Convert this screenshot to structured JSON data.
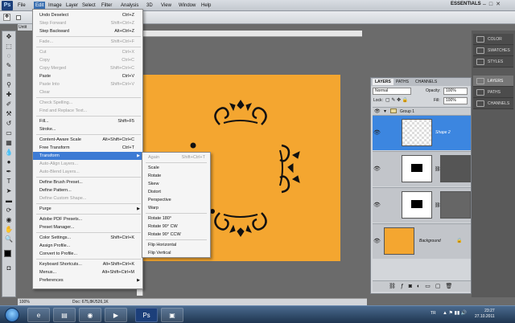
{
  "app": {
    "logo": "Ps",
    "workspace": "ESSENTIALS"
  },
  "menubar": [
    "File",
    "Edit",
    "Image",
    "Layer",
    "Select",
    "Filter",
    "Analysis",
    "3D",
    "View",
    "Window",
    "Help"
  ],
  "menubar_active": "Edit",
  "document_tab": "Untit",
  "edit_menu": [
    {
      "label": "Undo Deselect",
      "shortcut": "Ctrl+Z",
      "state": "enabled"
    },
    {
      "label": "Step Forward",
      "shortcut": "Shift+Ctrl+Z",
      "state": "disabled"
    },
    {
      "label": "Step Backward",
      "shortcut": "Alt+Ctrl+Z",
      "state": "enabled"
    },
    {
      "sep": true
    },
    {
      "label": "Fade...",
      "shortcut": "Shift+Ctrl+F",
      "state": "disabled"
    },
    {
      "sep": true
    },
    {
      "label": "Cut",
      "shortcut": "Ctrl+X",
      "state": "disabled"
    },
    {
      "label": "Copy",
      "shortcut": "Ctrl+C",
      "state": "disabled"
    },
    {
      "label": "Copy Merged",
      "shortcut": "Shift+Ctrl+C",
      "state": "disabled"
    },
    {
      "label": "Paste",
      "shortcut": "Ctrl+V",
      "state": "enabled"
    },
    {
      "label": "Paste Into",
      "shortcut": "Shift+Ctrl+V",
      "state": "disabled"
    },
    {
      "label": "Clear",
      "shortcut": "",
      "state": "disabled"
    },
    {
      "sep": true
    },
    {
      "label": "Check Spelling...",
      "shortcut": "",
      "state": "disabled"
    },
    {
      "label": "Find and Replace Text...",
      "shortcut": "",
      "state": "disabled"
    },
    {
      "sep": true
    },
    {
      "label": "Fill...",
      "shortcut": "Shift+F5",
      "state": "enabled"
    },
    {
      "label": "Stroke...",
      "shortcut": "",
      "state": "enabled"
    },
    {
      "sep": true
    },
    {
      "label": "Content-Aware Scale",
      "shortcut": "Alt+Shift+Ctrl+C",
      "state": "enabled"
    },
    {
      "label": "Free Transform",
      "shortcut": "Ctrl+T",
      "state": "enabled"
    },
    {
      "label": "Transform",
      "shortcut": "",
      "state": "highlighted",
      "submenu": true
    },
    {
      "label": "Auto-Align Layers...",
      "shortcut": "",
      "state": "disabled"
    },
    {
      "label": "Auto-Blend Layers...",
      "shortcut": "",
      "state": "disabled"
    },
    {
      "sep": true
    },
    {
      "label": "Define Brush Preset...",
      "shortcut": "",
      "state": "enabled"
    },
    {
      "label": "Define Pattern...",
      "shortcut": "",
      "state": "enabled"
    },
    {
      "label": "Define Custom Shape...",
      "shortcut": "",
      "state": "disabled"
    },
    {
      "sep": true
    },
    {
      "label": "Purge",
      "shortcut": "",
      "state": "enabled",
      "submenu": true
    },
    {
      "sep": true
    },
    {
      "label": "Adobe PDF Presets...",
      "shortcut": "",
      "state": "enabled"
    },
    {
      "label": "Preset Manager...",
      "shortcut": "",
      "state": "enabled"
    },
    {
      "sep": true
    },
    {
      "label": "Color Settings...",
      "shortcut": "Shift+Ctrl+K",
      "state": "enabled"
    },
    {
      "label": "Assign Profile...",
      "shortcut": "",
      "state": "enabled"
    },
    {
      "label": "Convert to Profile...",
      "shortcut": "",
      "state": "enabled"
    },
    {
      "sep": true
    },
    {
      "label": "Keyboard Shortcuts...",
      "shortcut": "Alt+Shift+Ctrl+K",
      "state": "enabled"
    },
    {
      "label": "Menus...",
      "shortcut": "Alt+Shift+Ctrl+M",
      "state": "enabled"
    },
    {
      "label": "Preferences",
      "shortcut": "",
      "state": "enabled",
      "submenu": true
    }
  ],
  "transform_submenu": [
    {
      "label": "Again",
      "shortcut": "Shift+Ctrl+T",
      "state": "disabled"
    },
    {
      "sep": true
    },
    {
      "label": "Scale",
      "state": "enabled"
    },
    {
      "label": "Rotate",
      "state": "enabled"
    },
    {
      "label": "Skew",
      "state": "enabled"
    },
    {
      "label": "Distort",
      "state": "enabled"
    },
    {
      "label": "Perspective",
      "state": "enabled"
    },
    {
      "label": "Warp",
      "state": "enabled"
    },
    {
      "sep": true
    },
    {
      "label": "Rotate 180°",
      "state": "enabled"
    },
    {
      "label": "Rotate 90° CW",
      "state": "enabled"
    },
    {
      "label": "Rotate 90° CCW",
      "state": "enabled"
    },
    {
      "sep": true
    },
    {
      "label": "Flip Horizontal",
      "state": "enabled"
    },
    {
      "label": "Flip Vertical",
      "state": "enabled"
    }
  ],
  "layers_panel": {
    "tabs": [
      "LAYERS",
      "PATHS",
      "CHANNELS"
    ],
    "blend_mode": "Normal",
    "opacity_label": "Opacity:",
    "opacity": "100%",
    "lock_label": "Lock:",
    "fill_label": "Fill:",
    "fill": "100%",
    "group_name": "Group 1",
    "layers": [
      {
        "name": "Shape 2",
        "selected": true
      },
      {
        "name": "",
        "selected": false
      },
      {
        "name": "",
        "selected": false
      },
      {
        "name": "Background",
        "selected": false
      }
    ]
  },
  "right_dock": [
    {
      "label": "COLOR",
      "icon": "color-icon"
    },
    {
      "label": "SWATCHES",
      "icon": "swatches-icon"
    },
    {
      "label": "STYLES",
      "icon": "styles-icon"
    },
    {
      "label": "LAYERS",
      "icon": "layers-icon"
    },
    {
      "label": "PATHS",
      "icon": "paths-icon"
    },
    {
      "label": "CHANNELS",
      "icon": "channels-icon"
    }
  ],
  "statusbar": {
    "zoom": "100%",
    "doc": "Doc: 675,8K/526,1K"
  },
  "canvas_color": "#f4a630",
  "taskbar": {
    "lang": "TR",
    "time": "23:27",
    "date": "27.10.2011"
  }
}
